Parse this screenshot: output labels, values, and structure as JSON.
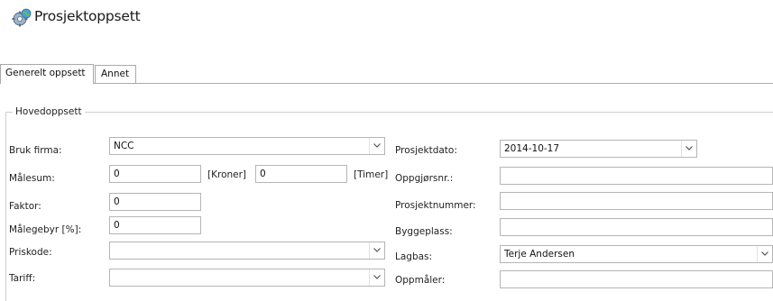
{
  "header": {
    "title": "Prosjektoppsett",
    "icon": "gear-globe-icon"
  },
  "tabs": [
    {
      "label": "Generelt oppsett",
      "active": true
    },
    {
      "label": "Annet",
      "active": false
    }
  ],
  "group": {
    "title": "Hovedoppsett"
  },
  "left": {
    "bruk_firma": {
      "label": "Bruk firma:",
      "value": "NCC"
    },
    "malesum": {
      "label": "Målesum:",
      "kroner_value": "0",
      "kroner_unit": "[Kroner]",
      "timer_value": "0",
      "timer_unit": "[Timer]"
    },
    "faktor": {
      "label": "Faktor:",
      "value": "0"
    },
    "malegebyr": {
      "label": "Målegebyr [%]:",
      "value": "0"
    },
    "priskode": {
      "label": "Priskode:",
      "value": ""
    },
    "tariff": {
      "label": "Tariff:",
      "value": ""
    }
  },
  "right": {
    "prosjektdato": {
      "label": "Prosjektdato:",
      "value": "2014-10-17"
    },
    "oppgjorsnr": {
      "label": "Oppgjørsnr.:",
      "value": ""
    },
    "prosjektnummer": {
      "label": "Prosjektnummer:",
      "value": ""
    },
    "byggeplass": {
      "label": "Byggeplass:",
      "value": ""
    },
    "lagbas": {
      "label": "Lagbas:",
      "value": "Terje Andersen"
    },
    "oppmaler": {
      "label": "Oppmåler:",
      "value": ""
    }
  }
}
